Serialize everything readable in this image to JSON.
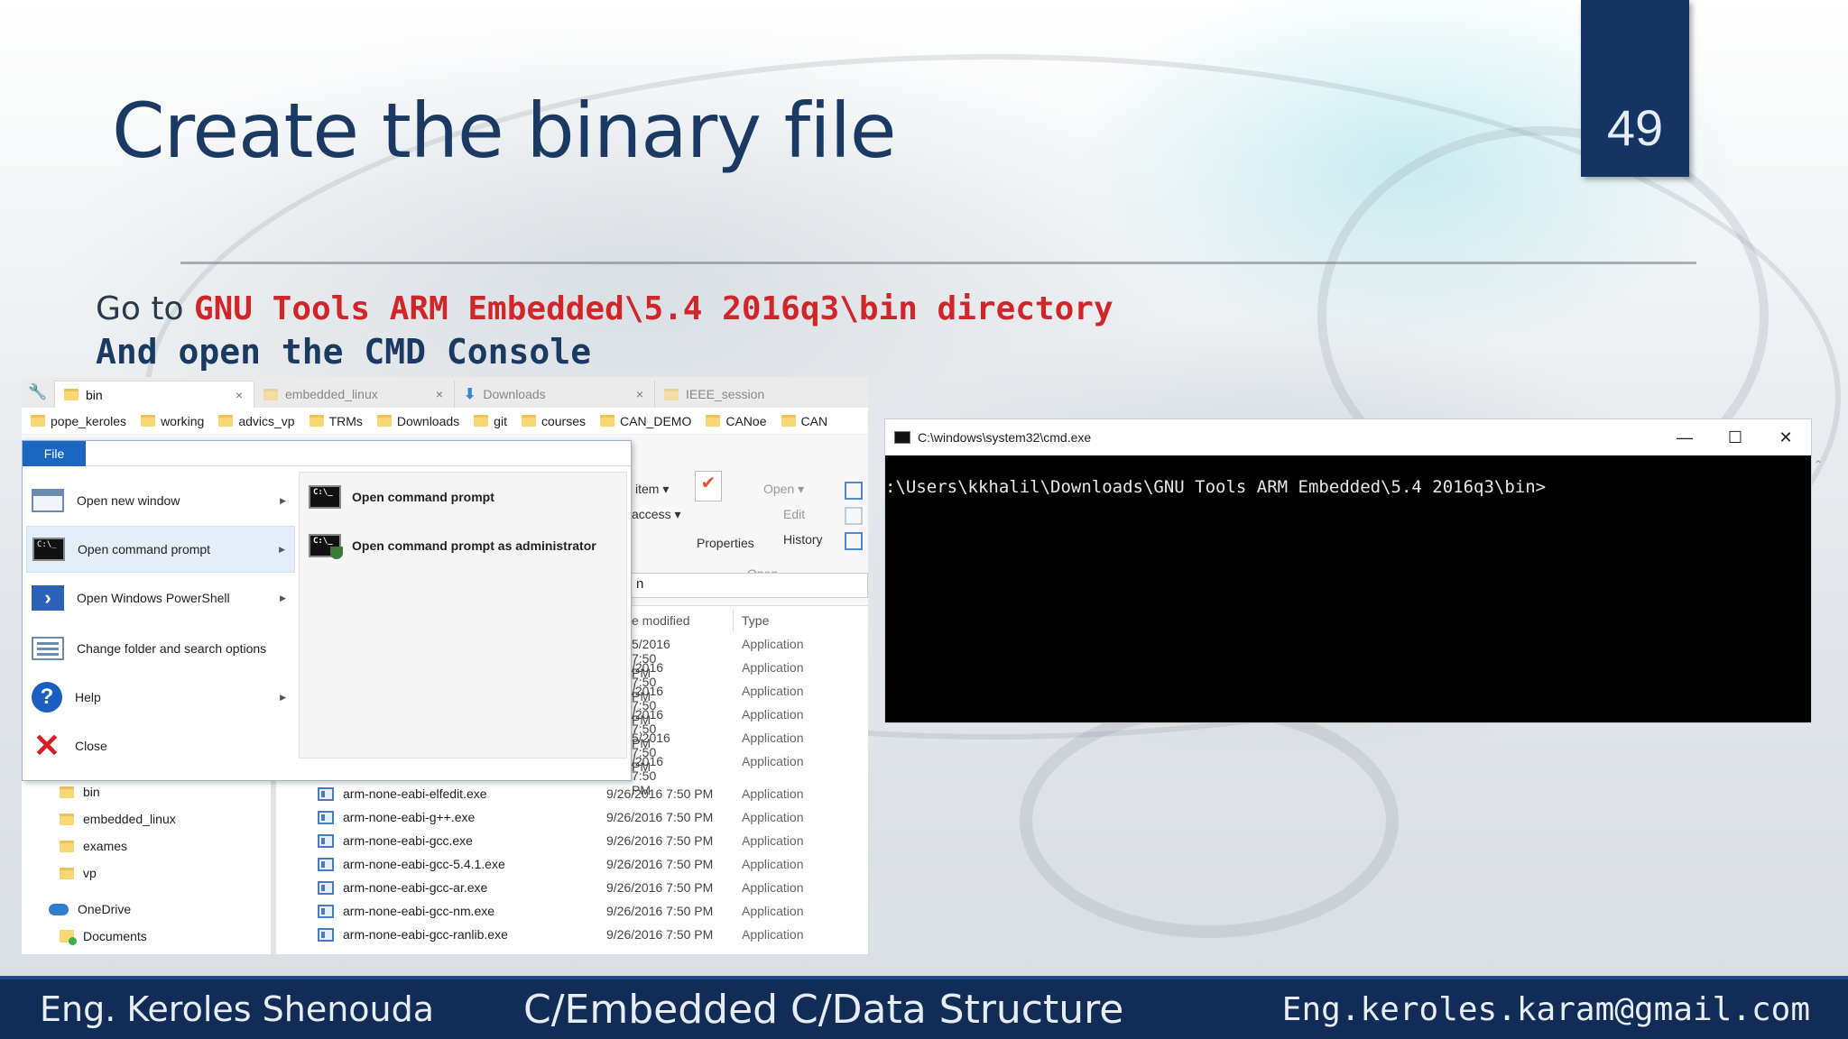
{
  "slide": {
    "page_number": "49",
    "title": "Create the binary file",
    "line1_prefix": "Go to ",
    "line1_code": "GNU Tools ARM Embedded\\5.4 2016q3\\bin directory",
    "line2": "And open the CMD Console"
  },
  "explorer": {
    "tabs": [
      {
        "label": "bin",
        "close": "×"
      },
      {
        "label": "embedded_linux",
        "close": "×"
      },
      {
        "label": "Downloads",
        "close": "×"
      },
      {
        "label": "IEEE_session"
      }
    ],
    "favorites": [
      "pope_keroles",
      "working",
      "advics_vp",
      "TRMs",
      "Downloads",
      "git",
      "courses",
      "CAN_DEMO",
      "CANoe",
      "CAN"
    ],
    "ribbon": {
      "item": "item ▾",
      "access": "access ▾",
      "properties": "Properties",
      "open": "Open ▾",
      "edit": "Edit",
      "history": "History",
      "group_open": "Open"
    },
    "path_fragment": "n",
    "columns": {
      "modified": "e modified",
      "type": "Type"
    },
    "hidden_rows": [
      {
        "date": "5/2016 7:50 PM",
        "type": "Application"
      },
      {
        "date": "/2016 7:50 PM",
        "type": "Application"
      },
      {
        "date": "/2016 7:50 PM",
        "type": "Application"
      },
      {
        "date": "/2016 7:50 PM",
        "type": "Application"
      },
      {
        "date": "5/2016 7:50 PM",
        "type": "Application"
      },
      {
        "date": "/2016 7:50 PM",
        "type": "Application"
      }
    ],
    "files": [
      {
        "name": "arm-none-eabi-elfedit.exe",
        "date": "9/26/2016 7:50 PM",
        "type": "Application"
      },
      {
        "name": "arm-none-eabi-g++.exe",
        "date": "9/26/2016 7:50 PM",
        "type": "Application"
      },
      {
        "name": "arm-none-eabi-gcc.exe",
        "date": "9/26/2016 7:50 PM",
        "type": "Application"
      },
      {
        "name": "arm-none-eabi-gcc-5.4.1.exe",
        "date": "9/26/2016 7:50 PM",
        "type": "Application"
      },
      {
        "name": "arm-none-eabi-gcc-ar.exe",
        "date": "9/26/2016 7:50 PM",
        "type": "Application"
      },
      {
        "name": "arm-none-eabi-gcc-nm.exe",
        "date": "9/26/2016 7:50 PM",
        "type": "Application"
      },
      {
        "name": "arm-none-eabi-gcc-ranlib.exe",
        "date": "9/26/2016 7:50 PM",
        "type": "Application"
      }
    ],
    "nav": [
      "bin",
      "embedded_linux",
      "exames",
      "vp",
      "OneDrive",
      "Documents"
    ],
    "file_menu": {
      "file_tab": "File",
      "items": [
        "Open new window",
        "Open command prompt",
        "Open Windows PowerShell",
        "Change folder and search options",
        "Help",
        "Close"
      ],
      "sub_items": [
        "Open command prompt",
        "Open command prompt as administrator"
      ]
    }
  },
  "cmd": {
    "title": "C:\\windows\\system32\\cmd.exe",
    "minimize": "—",
    "maximize": "☐",
    "close": "✕",
    "prompt": ":\\Users\\kkhalil\\Downloads\\GNU Tools ARM Embedded\\5.4 2016q3\\bin>"
  },
  "footer": {
    "author": "Eng. Keroles Shenouda",
    "course": "C/Embedded C/Data Structure",
    "email": "Eng.keroles.karam@gmail.com"
  },
  "icons": [
    "wrench-icon",
    "folder-icon",
    "download-arrow-icon",
    "cmd-icon",
    "window-icon",
    "powershell-icon",
    "options-icon",
    "help-icon",
    "close-icon",
    "exe-icon",
    "onedrive-icon",
    "documents-icon"
  ],
  "colors": {
    "accent_red": "#d0262a",
    "title_blue": "#1b3a63",
    "footer_blue": "#102c57",
    "file_tab_blue": "#1b66c0"
  }
}
